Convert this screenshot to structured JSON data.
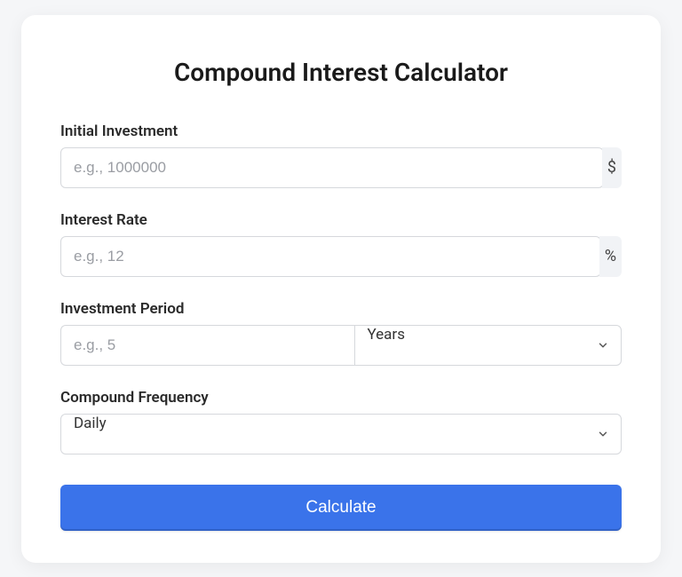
{
  "title": "Compound Interest Calculator",
  "fields": {
    "initial_investment": {
      "label": "Initial Investment",
      "placeholder": "e.g., 1000000",
      "suffix": "$"
    },
    "interest_rate": {
      "label": "Interest Rate",
      "placeholder": "e.g., 12",
      "suffix": "%"
    },
    "investment_period": {
      "label": "Investment Period",
      "placeholder": "e.g., 5",
      "unit_selected": "Years"
    },
    "compound_frequency": {
      "label": "Compound Frequency",
      "selected": "Daily"
    }
  },
  "button": {
    "calculate": "Calculate"
  }
}
